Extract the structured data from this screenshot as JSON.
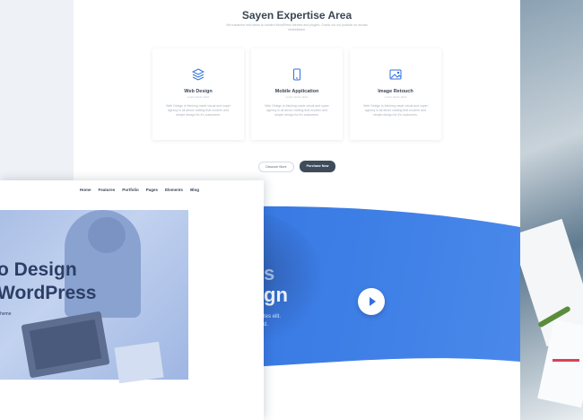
{
  "section": {
    "title": "Sayen Expertise Area",
    "subtitle": "We transform new ideas to modern WordPress themes and plugins. Check out our portfolio on envato marketplace."
  },
  "cards": [
    {
      "icon": "layers-icon",
      "title": "Web Design",
      "subtitle": "Lorem ipsum dolor",
      "desc": "Web Design is thinking made visual and super agency is all about crafting that modern and simple design for it's customers."
    },
    {
      "icon": "mobile-icon",
      "title": "Mobile Application",
      "subtitle": "Lorem ipsum dolor",
      "desc": "Web Design is thinking made visual and super agency is all about crafting that modern and simple design for it's customers."
    },
    {
      "icon": "image-icon",
      "title": "Image Retouch",
      "subtitle": "Lorem ipsum dolor",
      "desc": "Web Design is thinking made visual and super agency is all about crafting that modern and simple design for it's customers."
    }
  ],
  "buttons": {
    "discover": "Discover More",
    "purchase": "Purchase Now"
  },
  "hero_back": {
    "line1": "s",
    "line2": "gn",
    "line3": "tes elit.",
    "line4": "d."
  },
  "front": {
    "nav": [
      "Home",
      "Features",
      "Portfolio",
      "Pages",
      "Elements",
      "Blog"
    ],
    "title1": "o Design",
    "title2": "WordPress",
    "subtitle": "heme"
  },
  "colors": {
    "accent": "#2f6fde",
    "dark": "#3e4b5a",
    "text": "#3a4654"
  }
}
